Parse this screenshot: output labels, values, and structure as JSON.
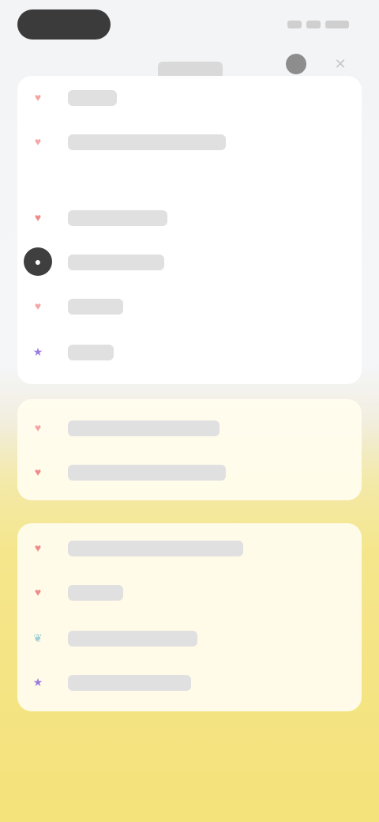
{
  "status_bar": {
    "pill_icon": "dark-pill",
    "system_icons": [
      "signal-icon",
      "wifi-icon",
      "battery-icon"
    ]
  },
  "header": {
    "title": "",
    "avatar_icon": "avatar-icon",
    "close_icon": "close-icon"
  },
  "sections": {
    "top": [
      {
        "icon": "heart-icon",
        "label": ""
      },
      {
        "icon": "heart-icon",
        "label": ""
      },
      {
        "icon": "heart-icon",
        "label": ""
      },
      {
        "icon": "avatar-icon",
        "label": ""
      },
      {
        "icon": "heart-icon",
        "label": ""
      },
      {
        "icon": "star-icon",
        "label": ""
      }
    ],
    "middle": [
      {
        "icon": "heart-icon",
        "label": ""
      },
      {
        "icon": "heart-icon",
        "label": ""
      }
    ],
    "bottom": [
      {
        "icon": "heart-icon",
        "label": ""
      },
      {
        "icon": "heart-icon",
        "label": ""
      },
      {
        "icon": "leaf-icon",
        "label": ""
      },
      {
        "icon": "star-icon",
        "label": ""
      }
    ]
  }
}
